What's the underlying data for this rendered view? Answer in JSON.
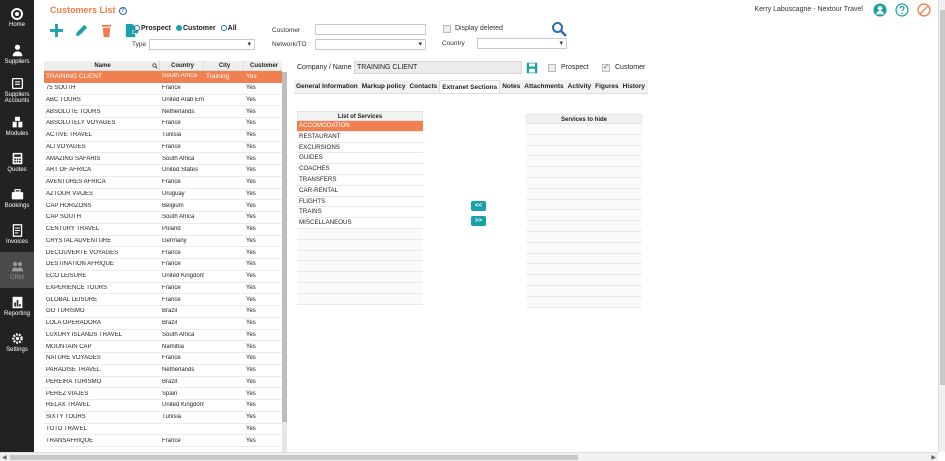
{
  "sidebar": {
    "items": [
      {
        "label": "Home",
        "icon": "home-icon"
      },
      {
        "label": "Suppliers",
        "icon": "suppliers-icon"
      },
      {
        "label": "Suppliers Accounts",
        "icon": "suppliers-accounts-icon"
      },
      {
        "label": "Modules",
        "icon": "modules-icon"
      },
      {
        "label": "Quotes",
        "icon": "quotes-icon"
      },
      {
        "label": "Bookings",
        "icon": "bookings-icon"
      },
      {
        "label": "Invoices",
        "icon": "invoices-icon"
      },
      {
        "label": "CRM",
        "icon": "crm-icon"
      },
      {
        "label": "Reporting",
        "icon": "reporting-icon"
      },
      {
        "label": "Settings",
        "icon": "settings-icon"
      }
    ]
  },
  "header": {
    "title": "Customers List",
    "user": "Kerry Labuscagne - Nextour Travel",
    "radios": {
      "prospect": "Prospect",
      "customer": "Customer",
      "all": "All"
    },
    "labels": {
      "type": "Type",
      "customer": "Customer",
      "network": "Network/TO",
      "display_deleted": "Display deleted",
      "country": "Country"
    }
  },
  "list": {
    "columns": [
      "Name",
      "Country",
      "City",
      "Customer"
    ],
    "rows": [
      {
        "name": "TRAINING CLIENT",
        "country": "South Africa",
        "city": "Training",
        "customer": "Yes"
      },
      {
        "name": "75 SOUTH",
        "country": "France",
        "city": "",
        "customer": "Yes"
      },
      {
        "name": "ABC TOURS",
        "country": "United Arab Emirates",
        "city": "",
        "customer": "Yes"
      },
      {
        "name": "ABSOLUTE TOURS",
        "country": "Netherlands",
        "city": "",
        "customer": "Yes"
      },
      {
        "name": "ABSOLUTELY VOYAGES",
        "country": "France",
        "city": "",
        "customer": "Yes"
      },
      {
        "name": "ACTIVE TRAVEL",
        "country": "Tunisia",
        "city": "",
        "customer": "Yes"
      },
      {
        "name": "ALI VOYAGES",
        "country": "France",
        "city": "",
        "customer": "Yes"
      },
      {
        "name": "AMAZING SAFARIS",
        "country": "South Africa",
        "city": "",
        "customer": "Yes"
      },
      {
        "name": "ART OF AFRICA",
        "country": "United States",
        "city": "",
        "customer": "Yes"
      },
      {
        "name": "AVENTURES AFRICA",
        "country": "France",
        "city": "",
        "customer": "Yes"
      },
      {
        "name": "AZTOUR VIAJES",
        "country": "Uruguay",
        "city": "",
        "customer": "Yes"
      },
      {
        "name": "CAP HORIZONS",
        "country": "Belgium",
        "city": "",
        "customer": "Yes"
      },
      {
        "name": "CAP SOUTH",
        "country": "South Africa",
        "city": "",
        "customer": "Yes"
      },
      {
        "name": "CENTURY TRAVEL",
        "country": "Poland",
        "city": "",
        "customer": "Yes"
      },
      {
        "name": "CRYSTAL ADVENTURE",
        "country": "Germany",
        "city": "",
        "customer": "Yes"
      },
      {
        "name": "DECOUVERTE VOYAGES",
        "country": "France",
        "city": "",
        "customer": "Yes"
      },
      {
        "name": "DESTINATION AFRIQUE",
        "country": "France",
        "city": "",
        "customer": "Yes"
      },
      {
        "name": "ECO LEISURE",
        "country": "United Kingdom",
        "city": "",
        "customer": "Yes"
      },
      {
        "name": "EXPERIENCE TOURS",
        "country": "France",
        "city": "",
        "customer": "Yes"
      },
      {
        "name": "GLOBAL LEISURE",
        "country": "France",
        "city": "",
        "customer": "Yes"
      },
      {
        "name": "GO TURISMO",
        "country": "Brazil",
        "city": "",
        "customer": "Yes"
      },
      {
        "name": "LOLA OPERADORA",
        "country": "Brazil",
        "city": "",
        "customer": "Yes"
      },
      {
        "name": "LUXURY ISLANDS TRAVEL",
        "country": "South Africa",
        "city": "",
        "customer": "Yes"
      },
      {
        "name": "MOUNTAIN CAP",
        "country": "Namibia",
        "city": "",
        "customer": "Yes"
      },
      {
        "name": "NATURE VOYAGES",
        "country": "France",
        "city": "",
        "customer": "Yes"
      },
      {
        "name": "PARADISE TRAVEL",
        "country": "Netherlands",
        "city": "",
        "customer": "Yes"
      },
      {
        "name": "PEREIRA TURISMO",
        "country": "Brazil",
        "city": "",
        "customer": "Yes"
      },
      {
        "name": "PEREZ VIAJES",
        "country": "Spain",
        "city": "",
        "customer": "Yes"
      },
      {
        "name": "RELAX TRAVEL",
        "country": "United Kingdom",
        "city": "",
        "customer": "Yes"
      },
      {
        "name": "SIXTY TOURS",
        "country": "Tunisia",
        "city": "",
        "customer": "Yes"
      },
      {
        "name": "TOTO TRAVEL",
        "country": "",
        "city": "",
        "customer": "Yes"
      },
      {
        "name": "TRANSAFRIQUE",
        "country": "France",
        "city": "",
        "customer": "Yes"
      }
    ]
  },
  "detail": {
    "company_label": "Company / Name",
    "company_value": "TRAINING CLIENT",
    "prospect_label": "Prospect",
    "customer_label": "Customer",
    "customer_checkmark": "✓",
    "tabs": [
      "General Information",
      "Markup policy",
      "Contacts",
      "Extranet Sections",
      "Notes",
      "Attachments",
      "Activity",
      "Figures",
      "History"
    ],
    "active_tab": "Extranet Sections",
    "services_header": "List of Services",
    "services": [
      "ACCOMODATION",
      "RESTAURANT",
      "EXCURSIONS",
      "GUIDES",
      "COACHES",
      "TRANSFERS",
      "CAR-RENTAL",
      "FLIGHTS",
      "TRAINS",
      "MISCELLANEOUS"
    ],
    "hide_header": "Services to hide",
    "move_left": "<<",
    "move_right": ">>"
  }
}
